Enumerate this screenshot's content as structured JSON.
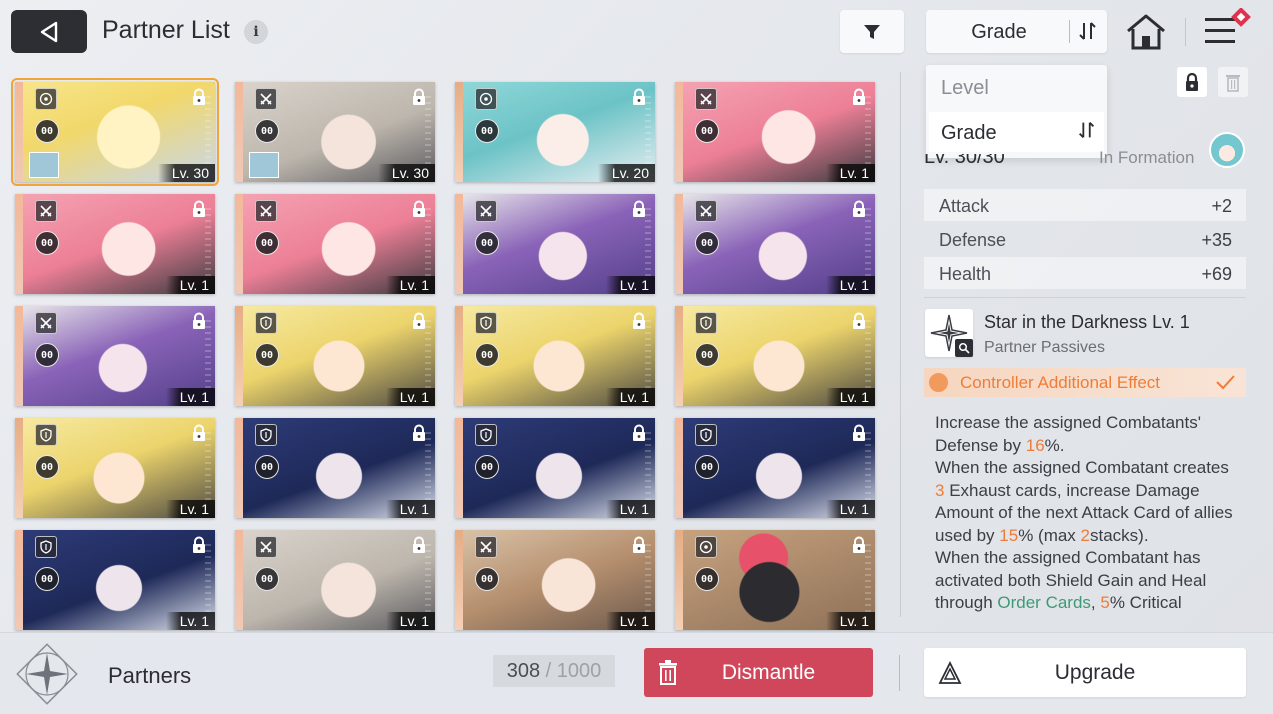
{
  "header": {
    "title": "Partner List",
    "info_glyph": "i",
    "sort_label": "Grade",
    "icons": [
      "back-arrow-icon",
      "info-icon",
      "filter-icon",
      "sort-order-icon",
      "home-icon",
      "menu-icon"
    ]
  },
  "sort_dropdown": {
    "options": [
      {
        "label": "Level",
        "selected": false
      },
      {
        "label": "Grade",
        "selected": true
      }
    ]
  },
  "partners": [
    {
      "level": "Lv. 30",
      "portrait": "blonde",
      "class_icon": "target-icon",
      "badge": "00",
      "locked": true,
      "selected": true,
      "has_mini_avatar": true
    },
    {
      "level": "Lv. 30",
      "portrait": "silver",
      "class_icon": "swords-icon",
      "badge": "00",
      "locked": true,
      "selected": false,
      "has_mini_avatar": true
    },
    {
      "level": "Lv. 20",
      "portrait": "teal",
      "class_icon": "target-icon",
      "badge": "00",
      "locked": true,
      "selected": false,
      "has_mini_avatar": false
    },
    {
      "level": "Lv. 1",
      "portrait": "pink",
      "class_icon": "swords-icon",
      "badge": "00",
      "locked": true,
      "selected": false,
      "has_mini_avatar": false
    },
    {
      "level": "Lv. 1",
      "portrait": "pink",
      "class_icon": "swords-icon",
      "badge": "00",
      "locked": true,
      "selected": false,
      "has_mini_avatar": false
    },
    {
      "level": "Lv. 1",
      "portrait": "pink",
      "class_icon": "swords-icon",
      "badge": "00",
      "locked": true,
      "selected": false,
      "has_mini_avatar": false
    },
    {
      "level": "Lv. 1",
      "portrait": "purple",
      "class_icon": "swords-icon",
      "badge": "00",
      "locked": true,
      "selected": false,
      "has_mini_avatar": false
    },
    {
      "level": "Lv. 1",
      "portrait": "purple",
      "class_icon": "swords-icon",
      "badge": "00",
      "locked": true,
      "selected": false,
      "has_mini_avatar": false
    },
    {
      "level": "Lv. 1",
      "portrait": "purple",
      "class_icon": "swords-icon",
      "badge": "00",
      "locked": true,
      "selected": false,
      "has_mini_avatar": false
    },
    {
      "level": "Lv. 1",
      "portrait": "headset",
      "class_icon": "shield-icon",
      "badge": "00",
      "locked": true,
      "selected": false,
      "has_mini_avatar": false
    },
    {
      "level": "Lv. 1",
      "portrait": "headset",
      "class_icon": "shield-icon",
      "badge": "00",
      "locked": true,
      "selected": false,
      "has_mini_avatar": false
    },
    {
      "level": "Lv. 1",
      "portrait": "headset",
      "class_icon": "shield-icon",
      "badge": "00",
      "locked": true,
      "selected": false,
      "has_mini_avatar": false
    },
    {
      "level": "Lv. 1",
      "portrait": "headset",
      "class_icon": "shield-icon",
      "badge": "00",
      "locked": true,
      "selected": false,
      "has_mini_avatar": false
    },
    {
      "level": "Lv. 1",
      "portrait": "navy",
      "class_icon": "shield-icon",
      "badge": "00",
      "locked": true,
      "selected": false,
      "has_mini_avatar": false
    },
    {
      "level": "Lv. 1",
      "portrait": "navy",
      "class_icon": "shield-icon",
      "badge": "00",
      "locked": true,
      "selected": false,
      "has_mini_avatar": false
    },
    {
      "level": "Lv. 1",
      "portrait": "navy",
      "class_icon": "shield-icon",
      "badge": "00",
      "locked": true,
      "selected": false,
      "has_mini_avatar": false
    },
    {
      "level": "Lv. 1",
      "portrait": "navy",
      "class_icon": "shield-icon",
      "badge": "00",
      "locked": true,
      "selected": false,
      "has_mini_avatar": false
    },
    {
      "level": "Lv. 1",
      "portrait": "silver",
      "class_icon": "swords-icon",
      "badge": "00",
      "locked": true,
      "selected": false,
      "has_mini_avatar": false
    },
    {
      "level": "Lv. 1",
      "portrait": "brown",
      "class_icon": "swords-icon",
      "badge": "00",
      "locked": true,
      "selected": false,
      "has_mini_avatar": false
    },
    {
      "level": "Lv. 1",
      "portrait": "mascot",
      "class_icon": "target-icon",
      "badge": "00",
      "locked": true,
      "selected": false,
      "has_mini_avatar": false
    }
  ],
  "detail": {
    "level_text": "Lv. 30/30",
    "formation_text": "In Formation",
    "stats": [
      {
        "name": "Attack",
        "value": "+2"
      },
      {
        "name": "Defense",
        "value": "+35"
      },
      {
        "name": "Health",
        "value": "+69"
      }
    ],
    "passive_title": "Star in the Darkness Lv. 1",
    "passive_subtitle": "Partner Passives",
    "effect_label": "Controller Additional Effect",
    "description_parts": [
      {
        "text": "Increase the assigned Combatants' Defense by ",
        "style": "normal"
      },
      {
        "text": "16",
        "style": "orange"
      },
      {
        "text": "%.",
        "style": "normal"
      },
      {
        "text": "\n",
        "style": "br"
      },
      {
        "text": "When the assigned Combatant creates ",
        "style": "normal"
      },
      {
        "text": "3",
        "style": "orange"
      },
      {
        "text": " Exhaust cards, increase Damage Amount of the next Attack Card of allies used by ",
        "style": "normal"
      },
      {
        "text": "15",
        "style": "orange"
      },
      {
        "text": "% (max ",
        "style": "normal"
      },
      {
        "text": "2",
        "style": "orange"
      },
      {
        "text": "stacks).",
        "style": "normal"
      },
      {
        "text": "\n",
        "style": "br"
      },
      {
        "text": "When the assigned Combatant has activated both Shield Gain and Heal through ",
        "style": "normal"
      },
      {
        "text": "Order Cards",
        "style": "green"
      },
      {
        "text": ", ",
        "style": "normal"
      },
      {
        "text": "5",
        "style": "orange"
      },
      {
        "text": "% Critical",
        "style": "normal"
      }
    ]
  },
  "footer": {
    "section_label": "Partners",
    "count_current": "308",
    "count_separator": " / ",
    "count_max": "1000",
    "dismantle_label": "Dismantle",
    "upgrade_label": "Upgrade"
  },
  "colors": {
    "accent_selected": "#f1a438",
    "dismantle": "#d0475b",
    "highlight_orange": "#ef7d37",
    "highlight_green": "#3d9a74"
  }
}
